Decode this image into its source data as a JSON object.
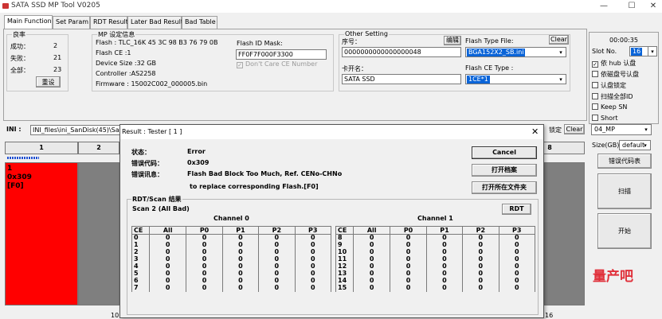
{
  "window": {
    "title": "SATA SSD MP Tool V0205",
    "min": "—",
    "max": "☐",
    "close": "✕"
  },
  "tabs": [
    "Main Function",
    "Set Param",
    "RDT Result",
    "Later Bad Result",
    "Bad Table"
  ],
  "yield": {
    "title": "良率",
    "success_label": "成功：",
    "success": "2",
    "fail_label": "失败：",
    "fail": "21",
    "total_label": "全部：",
    "total": "23",
    "reset": "重设"
  },
  "mp_info": {
    "title": "MP 设定信息",
    "flash": "Flash : TLC_16K 45 3C 98 B3 76 79 0B",
    "flash_ce": "Flash CE :1",
    "device_size": "Device Size :32 GB",
    "controller": "Controller :AS2258",
    "firmware": "Firmware : 15002C002_000005.bin",
    "flash_id_mask_label": "Flash ID Mask:",
    "flash_id_mask": "FF0F7F000F3300",
    "dont_care_ce": "Don't Care CE Number"
  },
  "other": {
    "title": "Other Setting",
    "serial_label": "序号：",
    "edit": "编辑",
    "serial": "0000000000000000048",
    "card_name_label": "卡开名：",
    "card_name": "SATA SSD",
    "flash_type_label": "Flash Type File:",
    "clear": "Clear",
    "flash_type": "BGA152X2_SB.ini",
    "flash_ce_type_label": "Flash CE Type :",
    "flash_ce_type": "1CE*1"
  },
  "right": {
    "time": "00:00:35",
    "slot_label": "Slot No.",
    "slot": "16",
    "opts": [
      "依 hub 认盘",
      "依磁盘号认盘",
      "认盘锁定",
      "扫描全部ID",
      "Keep SN",
      "Short"
    ],
    "opts_checked": [
      true,
      false,
      false,
      false,
      false,
      false
    ],
    "lock": "锁定",
    "clear": "Clear",
    "mode": "04_MP",
    "size_label": "Size(GB)",
    "size": "default",
    "error_codes": "错误代码表",
    "scan": "扫描",
    "start": "开始",
    "brand": "量产吧"
  },
  "ini": {
    "label": "INI :",
    "path": "INI_files\\ini_SanDisk(45)\\SanD"
  },
  "slots": {
    "h1": "1",
    "h2": "2",
    "h8": "8",
    "s1_text1": "1",
    "s1_text2": "0x309",
    "s1_text3": "[F0]",
    "bottom_left": "10",
    "bottom_right": "16"
  },
  "dialog": {
    "title": "Result : Tester [ 1 ]",
    "close": "✕",
    "status_label": "状态：",
    "status": "Error",
    "code_label": "错误代码：",
    "code": "0x309",
    "msg_label": "错误讯息：",
    "msg1": "Flash Bad Block Too Much, Ref. CENo-CHNo",
    "msg2": "to replace corresponding Flash.[F0]",
    "cancel": "Cancel",
    "open_file": "打开档案",
    "open_folder": "打开所在文件夹",
    "rdt_title": "RDT/Scan 结果",
    "scan_label": "Scan 2 (All Bad)",
    "rdt_btn": "RDT",
    "ch0_title": "Channel 0",
    "ch1_title": "Channel 1",
    "headers": [
      "CE",
      "All",
      "P0",
      "P1",
      "P2",
      "P3"
    ],
    "ch0_rows": [
      [
        "0",
        "0",
        "0",
        "0",
        "0",
        "0"
      ],
      [
        "1",
        "0",
        "0",
        "0",
        "0",
        "0"
      ],
      [
        "2",
        "0",
        "0",
        "0",
        "0",
        "0"
      ],
      [
        "3",
        "0",
        "0",
        "0",
        "0",
        "0"
      ],
      [
        "4",
        "0",
        "0",
        "0",
        "0",
        "0"
      ],
      [
        "5",
        "0",
        "0",
        "0",
        "0",
        "0"
      ],
      [
        "6",
        "0",
        "0",
        "0",
        "0",
        "0"
      ],
      [
        "7",
        "0",
        "0",
        "0",
        "0",
        "0"
      ]
    ],
    "ch1_rows": [
      [
        "8",
        "0",
        "0",
        "0",
        "0",
        "0"
      ],
      [
        "9",
        "0",
        "0",
        "0",
        "0",
        "0"
      ],
      [
        "10",
        "0",
        "0",
        "0",
        "0",
        "0"
      ],
      [
        "11",
        "0",
        "0",
        "0",
        "0",
        "0"
      ],
      [
        "12",
        "0",
        "0",
        "0",
        "0",
        "0"
      ],
      [
        "13",
        "0",
        "0",
        "0",
        "0",
        "0"
      ],
      [
        "14",
        "0",
        "0",
        "0",
        "0",
        "0"
      ],
      [
        "15",
        "0",
        "0",
        "0",
        "0",
        "0"
      ]
    ]
  }
}
